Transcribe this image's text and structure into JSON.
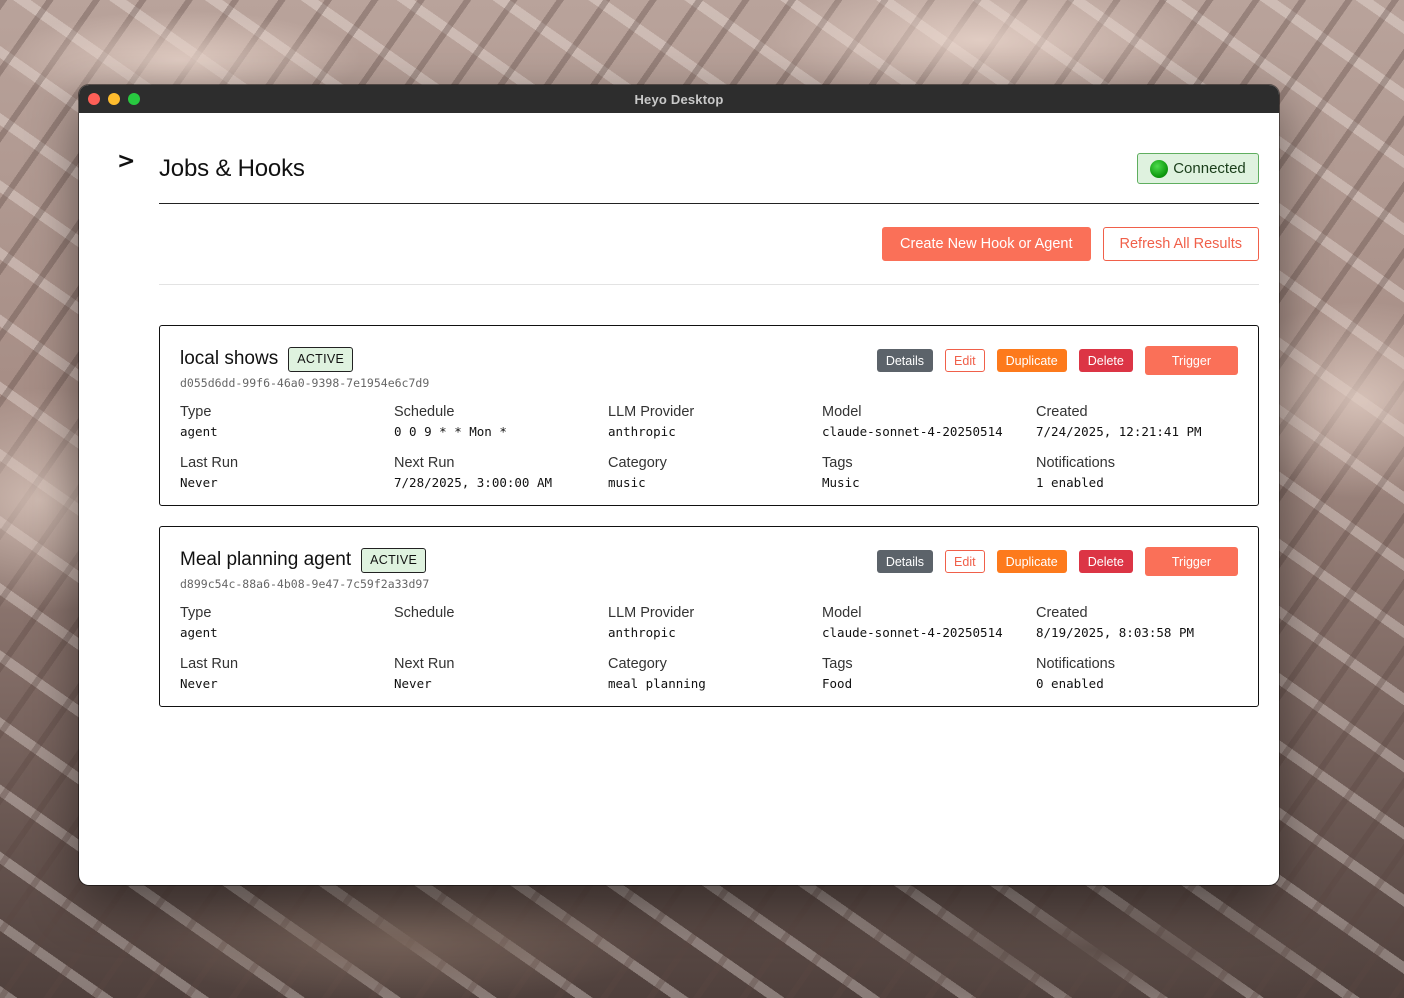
{
  "window": {
    "title": "Heyo Desktop"
  },
  "sidebar": {
    "toggle_glyph": ">"
  },
  "header": {
    "title": "Jobs & Hooks",
    "connection_label": "Connected",
    "connection_color": "#13a013"
  },
  "toolbar": {
    "create_label": "Create New Hook or Agent",
    "refresh_label": "Refresh All Results"
  },
  "field_labels": {
    "type": "Type",
    "schedule": "Schedule",
    "llm_provider": "LLM Provider",
    "model": "Model",
    "created": "Created",
    "last_run": "Last Run",
    "next_run": "Next Run",
    "category": "Category",
    "tags": "Tags",
    "notifications": "Notifications"
  },
  "action_labels": {
    "details": "Details",
    "edit": "Edit",
    "duplicate": "Duplicate",
    "delete": "Delete",
    "trigger": "Trigger"
  },
  "jobs": [
    {
      "name": "local shows",
      "status": "ACTIVE",
      "id": "d055d6dd-99f6-46a0-9398-7e1954e6c7d9",
      "type": "agent",
      "schedule": "0 0 9 * * Mon *",
      "llm_provider": "anthropic",
      "model": "claude-sonnet-4-20250514",
      "created": "7/24/2025, 12:21:41 PM",
      "last_run": "Never",
      "next_run": "7/28/2025, 3:00:00 AM",
      "category": "music",
      "tags": "Music",
      "notifications": "1 enabled"
    },
    {
      "name": "Meal planning agent",
      "status": "ACTIVE",
      "id": "d899c54c-88a6-4b08-9e47-7c59f2a33d97",
      "type": "agent",
      "schedule": "",
      "llm_provider": "anthropic",
      "model": "claude-sonnet-4-20250514",
      "created": "8/19/2025, 8:03:58 PM",
      "last_run": "Never",
      "next_run": "Never",
      "category": "meal planning",
      "tags": "Food",
      "notifications": "0 enabled"
    }
  ]
}
